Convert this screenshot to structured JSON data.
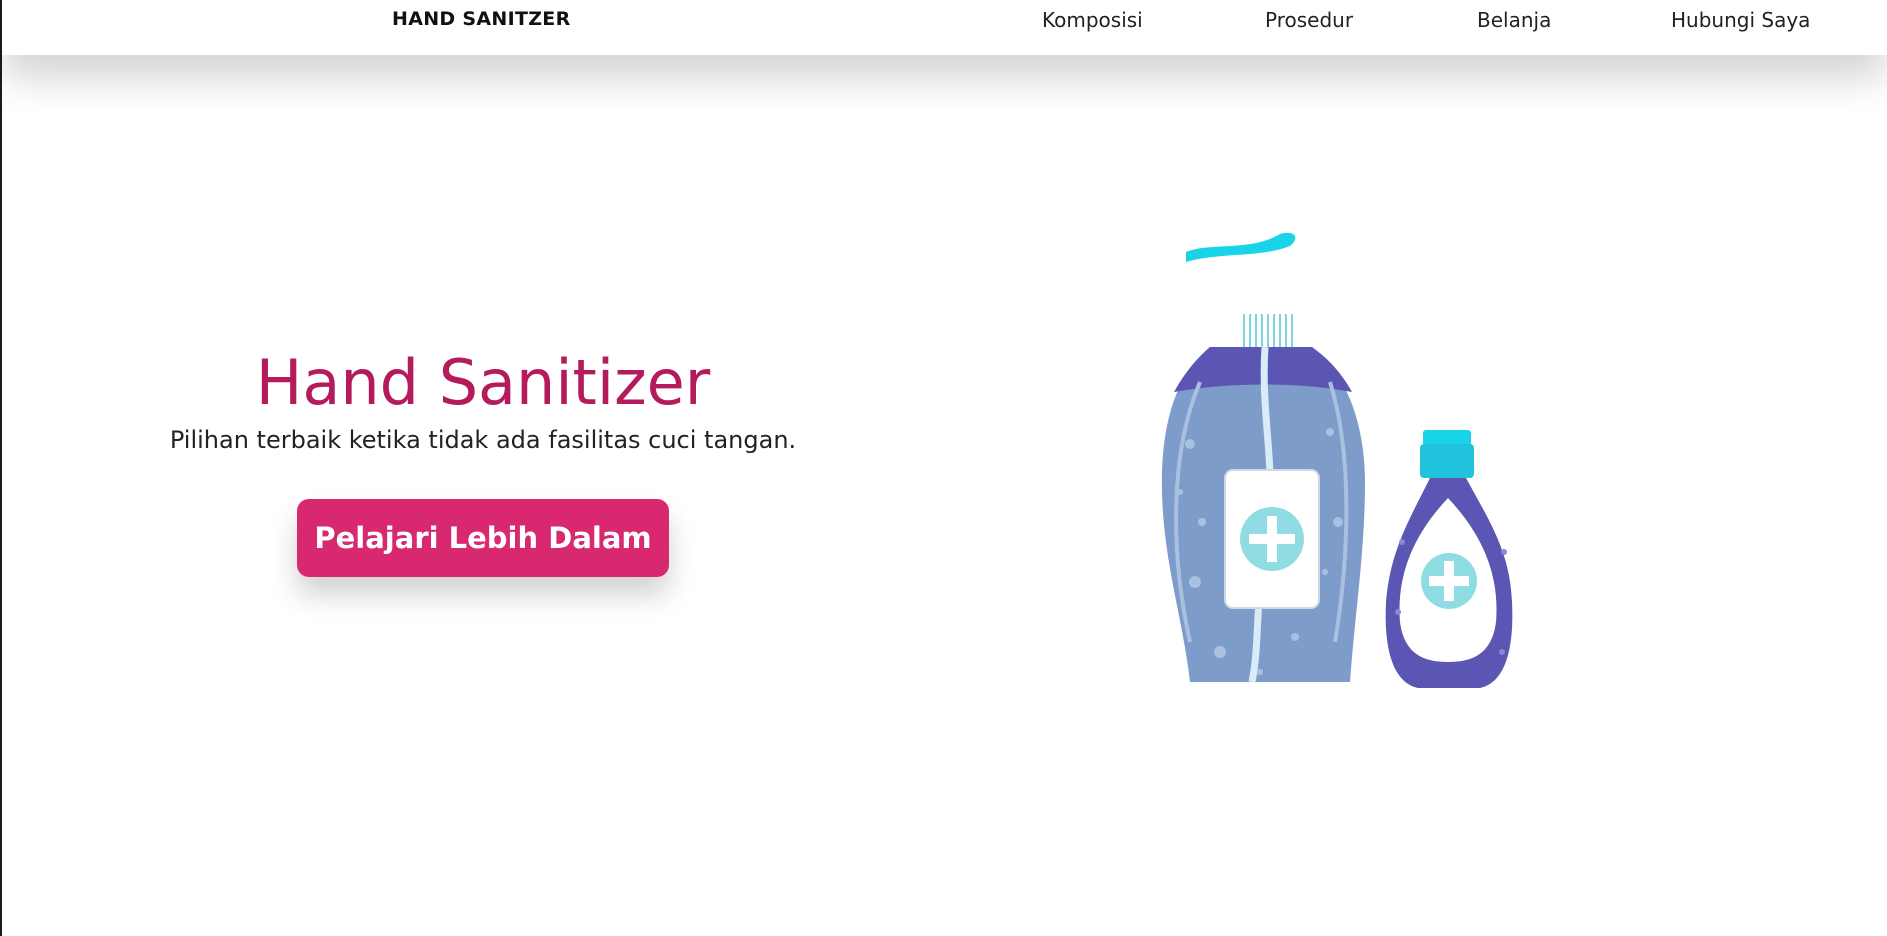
{
  "nav": {
    "brand": "HAND SANITZER",
    "links": [
      "Komposisi",
      "Prosedur",
      "Belanja",
      "Hubungi Saya"
    ]
  },
  "hero": {
    "title": "Hand Sanitizer",
    "subtitle": "Pilihan terbaik ketika tidak ada fasilitas cuci tangan.",
    "cta_label": "Pelajari Lebih Dalam"
  },
  "colors": {
    "title": "#b51a5c",
    "button": "#d8286f",
    "bottle_large": "#7d9cc9",
    "bottle_top": "#5b56b3",
    "cap": "#19d4e8",
    "cross_circle": "#8fdde3"
  },
  "icons": {
    "illustration": "hand-sanitizer-bottles"
  }
}
